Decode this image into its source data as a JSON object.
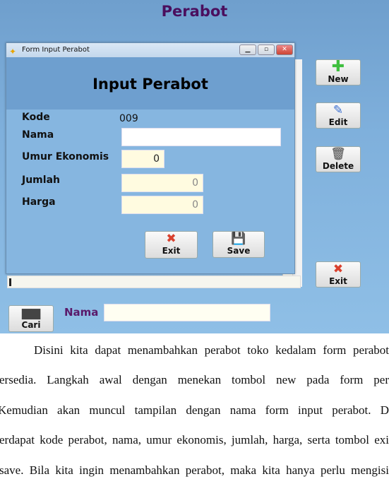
{
  "app": {
    "title": "Perabot",
    "buttons": [
      {
        "label": "New",
        "icon": "plus-icon",
        "color": "#3fbf3f"
      },
      {
        "label": "Edit",
        "icon": "pencil-icon",
        "color": "#3a6fd0"
      },
      {
        "label": "Delete",
        "icon": "trash-icon",
        "color": "#888888"
      },
      {
        "label": "Exit",
        "icon": "x-icon",
        "color": "#d9412e"
      }
    ],
    "search": {
      "button_label": "Cari",
      "button_icon": "binoculars-icon",
      "field_label": "Nama",
      "value": ""
    }
  },
  "dialog": {
    "window_title": "Form Input Perabot",
    "heading": "Input Perabot",
    "fields": {
      "kode_label": "Kode",
      "kode_value": "009",
      "nama_label": "Nama",
      "nama_value": "",
      "umur_label": "Umur Ekonomis",
      "umur_value": "0",
      "jumlah_label": "Jumlah",
      "jumlah_value": "0",
      "harga_label": "Harga",
      "harga_value": "0"
    },
    "exit_label": "Exit",
    "save_label": "Save"
  },
  "paragraph": [
    "Disini kita dapat menambahkan perabot toko kedalam form perabot",
    "ersedia. Langkah awal dengan menekan tombol new pada form per",
    "Kemudian akan muncul tampilan dengan nama form input perabot. D",
    "erdapat kode perabot, nama, umur ekonomis, jumlah, harga, serta tombol exi",
    "save. Bila kita ingin menambahkan perabot, maka kita hanya perlu mengisi"
  ]
}
